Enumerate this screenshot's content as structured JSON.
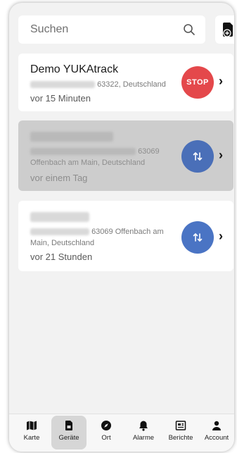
{
  "search": {
    "placeholder": "Suchen"
  },
  "devices": [
    {
      "name": "Demo YUKAtrack",
      "address_line1": "63322, Deutschland",
      "address_line2": "",
      "time": "vor 15 Minuten",
      "action": "STOP"
    },
    {
      "name": "",
      "address_line1": "63069",
      "address_line2": "Offenbach am Main, Deutschland",
      "time": "vor einem Tag",
      "action": "swap"
    },
    {
      "name": "",
      "address_line1": "63069 Offenbach am",
      "address_line2": "Main, Deutschland",
      "time": "vor 21 Stunden",
      "action": "swap"
    }
  ],
  "tabs": [
    {
      "label": "Karte",
      "icon": "map-icon",
      "active": false
    },
    {
      "label": "Geräte",
      "icon": "device-icon",
      "active": true
    },
    {
      "label": "Ort",
      "icon": "compass-icon",
      "active": false
    },
    {
      "label": "Alarme",
      "icon": "bell-icon",
      "active": false
    },
    {
      "label": "Berichte",
      "icon": "report-icon",
      "active": false
    },
    {
      "label": "Account",
      "icon": "person-icon",
      "active": false
    }
  ],
  "colors": {
    "stop": "#e4484b",
    "swap": "#4a74c4",
    "background": "#f2f2f2",
    "active_tab": "#d6d6d6"
  }
}
